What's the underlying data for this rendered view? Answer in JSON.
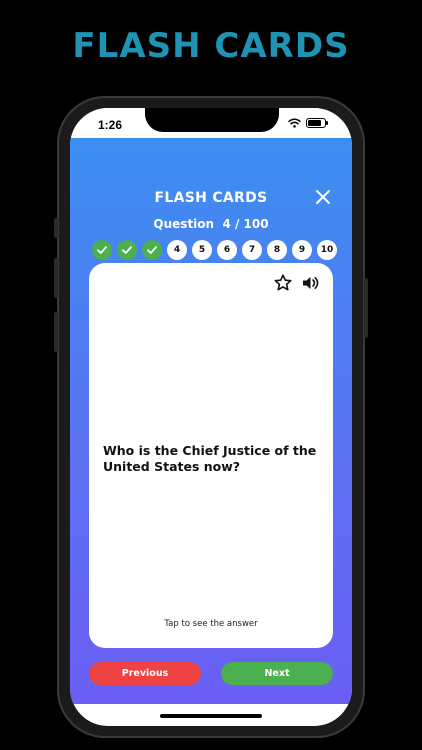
{
  "promo": {
    "title": "FLASH CARDS"
  },
  "status_bar": {
    "time": "1:26"
  },
  "header": {
    "title": "FLASH CARDS"
  },
  "counter": {
    "label": "Question  4 / 100"
  },
  "progress": {
    "completed": [
      1,
      2,
      3
    ],
    "pending_labels": [
      "4",
      "5",
      "6",
      "7",
      "8",
      "9",
      "10"
    ]
  },
  "card": {
    "question": "Who is the Chief Justice of the United States now?",
    "hint": "Tap to see the answer"
  },
  "footer": {
    "previous_label": "Previous",
    "next_label": "Next"
  },
  "colors": {
    "promo_title": "#1e93b4",
    "gradient_top": "#3b8ff0",
    "gradient_bottom": "#6a5ef4",
    "done_dot": "#4caf50",
    "previous_button": "#ef4343",
    "next_button": "#4caf50"
  },
  "icons": {
    "close": "close-icon",
    "favorite": "star-outline-icon",
    "audio": "speaker-icon",
    "check": "check-icon",
    "wifi": "wifi-icon",
    "battery": "battery-icon"
  }
}
